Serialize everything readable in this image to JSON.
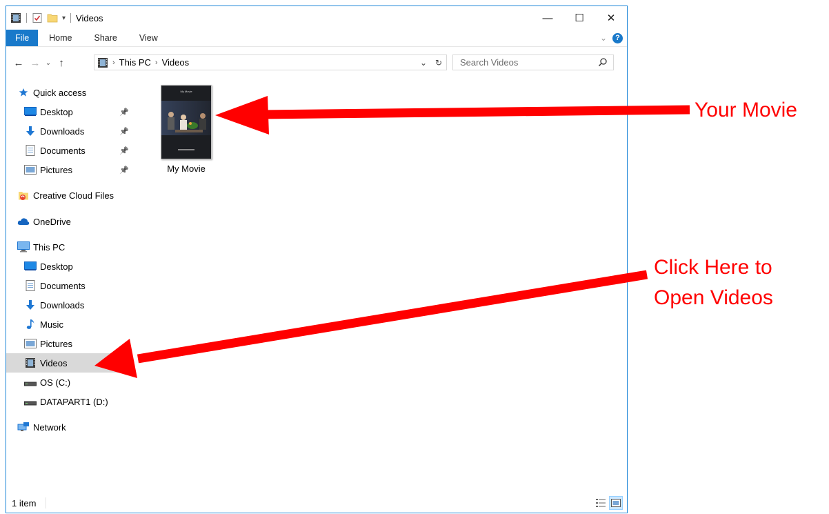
{
  "window": {
    "title": "Videos",
    "controls": {
      "minimize": "—",
      "maximize": "☐",
      "close": "✕"
    }
  },
  "ribbon": {
    "tabs": [
      {
        "label": "File"
      },
      {
        "label": "Home"
      },
      {
        "label": "Share"
      },
      {
        "label": "View"
      }
    ],
    "help_label": "?"
  },
  "navigation": {
    "back": "←",
    "forward": "→",
    "recent": "⌄",
    "up": "↑",
    "address_segments": [
      "This PC",
      "Videos"
    ],
    "search_placeholder": "Search Videos"
  },
  "nav_pane": {
    "items": [
      {
        "label": "Quick access",
        "icon": "star-icon",
        "indent": 0,
        "pinned": false,
        "selected": false
      },
      {
        "label": "Desktop",
        "icon": "desktop-icon",
        "indent": 1,
        "pinned": true,
        "selected": false
      },
      {
        "label": "Downloads",
        "icon": "download-icon",
        "indent": 1,
        "pinned": true,
        "selected": false
      },
      {
        "label": "Documents",
        "icon": "document-icon",
        "indent": 1,
        "pinned": true,
        "selected": false
      },
      {
        "label": "Pictures",
        "icon": "pictures-icon",
        "indent": 1,
        "pinned": true,
        "selected": false
      },
      {
        "label": "Creative Cloud Files",
        "icon": "creative-cloud-icon",
        "indent": 0,
        "pinned": false,
        "selected": false
      },
      {
        "label": "OneDrive",
        "icon": "cloud-icon",
        "indent": 0,
        "pinned": false,
        "selected": false
      },
      {
        "label": "This PC",
        "icon": "computer-icon",
        "indent": 0,
        "pinned": false,
        "selected": false
      },
      {
        "label": "Desktop",
        "icon": "desktop-icon",
        "indent": 1,
        "pinned": false,
        "selected": false
      },
      {
        "label": "Documents",
        "icon": "document-icon",
        "indent": 1,
        "pinned": false,
        "selected": false
      },
      {
        "label": "Downloads",
        "icon": "download-icon",
        "indent": 1,
        "pinned": false,
        "selected": false
      },
      {
        "label": "Music",
        "icon": "music-icon",
        "indent": 1,
        "pinned": false,
        "selected": false
      },
      {
        "label": "Pictures",
        "icon": "pictures-icon",
        "indent": 1,
        "pinned": false,
        "selected": false
      },
      {
        "label": "Videos",
        "icon": "film-icon",
        "indent": 1,
        "pinned": false,
        "selected": true
      },
      {
        "label": "OS (C:)",
        "icon": "drive-icon",
        "indent": 1,
        "pinned": false,
        "selected": false
      },
      {
        "label": "DATAPART1 (D:)",
        "icon": "drive-icon",
        "indent": 1,
        "pinned": false,
        "selected": false
      },
      {
        "label": "Network",
        "icon": "network-icon",
        "indent": 0,
        "pinned": false,
        "selected": false
      }
    ]
  },
  "content": {
    "files": [
      {
        "name": "My Movie",
        "thumbnail_title": "My Movie"
      }
    ]
  },
  "status": {
    "item_count": "1 item"
  },
  "annotations": {
    "top_callout": "Your Movie",
    "bottom_callout": [
      "Click Here to",
      "Open Videos"
    ],
    "arrow_color": "#ff0000"
  }
}
